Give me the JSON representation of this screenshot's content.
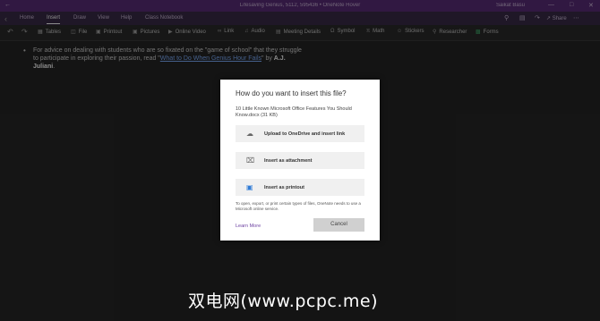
{
  "window": {
    "title": "Lifesaving Genius, 5112, 595436 • OneNote Hover",
    "user": "Saikat Basu",
    "back_icon": "back-arrow-icon"
  },
  "tabs": [
    "Home",
    "Insert",
    "Draw",
    "View",
    "Help",
    "Class Notebook"
  ],
  "ribbon": {
    "items": [
      {
        "label": "Tables",
        "icon": "table-icon"
      },
      {
        "label": "File",
        "icon": "attach-icon"
      },
      {
        "label": "Printout",
        "icon": "printout-icon"
      },
      {
        "label": "Pictures",
        "icon": "picture-icon"
      },
      {
        "label": "Online Video",
        "icon": "video-icon"
      },
      {
        "label": "Link",
        "icon": "link-icon"
      },
      {
        "label": "Audio",
        "icon": "audio-icon"
      },
      {
        "label": "Meeting Details",
        "icon": "meeting-icon"
      },
      {
        "label": "Symbol",
        "icon": "omega-icon"
      },
      {
        "label": "Math",
        "icon": "math-icon"
      },
      {
        "label": "Stickers",
        "icon": "sticker-icon"
      },
      {
        "label": "Researcher",
        "icon": "researcher-icon"
      },
      {
        "label": "Forms",
        "icon": "forms-icon"
      }
    ],
    "share_label": "Share"
  },
  "content": {
    "text1": "For advice on dealing with students who are so fixated on the \"game of school\" that they struggle to participate in exploring their passion, read \"",
    "link": "What to Do When Genius Hour Fails",
    "text2": "\" by ",
    "author": "A.J. Juliani",
    "text3": "."
  },
  "dialog": {
    "title": "How do you want to insert this file?",
    "file": "10 Little Known Microsoft Office Features You Should Know.docx (31 KB)",
    "options": [
      {
        "label": "Upload to OneDrive and insert link",
        "icon": "cloud-upload-icon"
      },
      {
        "label": "Insert as attachment",
        "icon": "paperclip-icon"
      },
      {
        "label": "Insert as printout",
        "icon": "printout-icon"
      }
    ],
    "note": "To open, export, or print certain types of files, OneNote needs to use a Microsoft online service.",
    "learn_more": "Learn More",
    "cancel": "Cancel"
  },
  "watermark": "双电网(www.pcpc.me)"
}
